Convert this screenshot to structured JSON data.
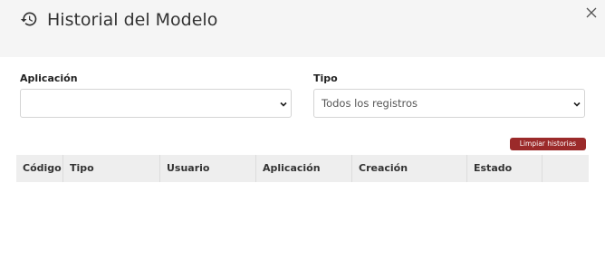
{
  "modal": {
    "title": "Historial del Modelo"
  },
  "filters": {
    "application": {
      "label": "Aplicación",
      "value": ""
    },
    "type": {
      "label": "Tipo",
      "value": "Todos los registros"
    }
  },
  "actions": {
    "clear_label": "Limpiar historias"
  },
  "table": {
    "columns": [
      "Código",
      "Tipo",
      "Usuario",
      "Aplicación",
      "Creación",
      "Estado",
      ""
    ],
    "rows": []
  },
  "colors": {
    "header_bg": "#f5f5f5",
    "accent": "#9b2a2a",
    "table_head_bg": "#eeeeee"
  }
}
